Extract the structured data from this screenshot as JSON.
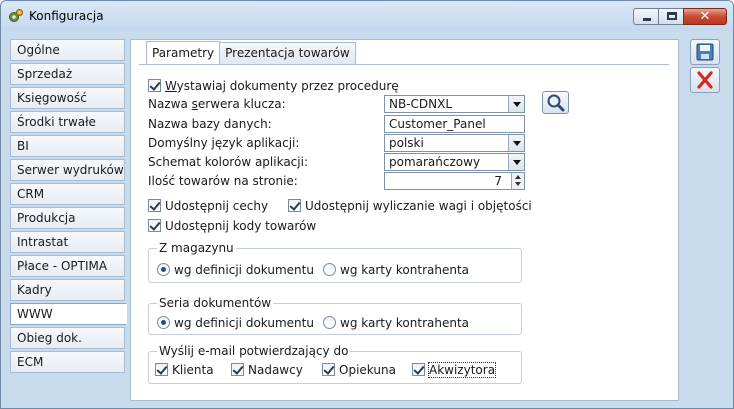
{
  "window": {
    "title": "Konfiguracja",
    "close_label": "✕"
  },
  "sidebar": {
    "items": [
      {
        "label": "Ogólne"
      },
      {
        "label": "Sprzedaż"
      },
      {
        "label": "Księgowość"
      },
      {
        "label": "Środki trwałe"
      },
      {
        "label": "BI"
      },
      {
        "label": "Serwer wydruków"
      },
      {
        "label": "CRM"
      },
      {
        "label": "Produkcja"
      },
      {
        "label": "Intrastat"
      },
      {
        "label": "Płace - OPTIMA"
      },
      {
        "label": "Kadry"
      },
      {
        "label": "WWW"
      },
      {
        "label": "Obieg dok."
      },
      {
        "label": "ECM"
      }
    ],
    "active_index": 11
  },
  "tabs": [
    {
      "label": "Parametry"
    },
    {
      "label": "Prezentacja towarów"
    }
  ],
  "form": {
    "use_procedure": {
      "label_pre": "",
      "label_u": "W",
      "label_post": "ystawiaj dokumenty przez procedurę",
      "checked": true
    },
    "server_key": {
      "label_pre": "Nazwa ",
      "label_u": "s",
      "label_post": "erwera klucza:",
      "value": "NB-CDNXL"
    },
    "db_name": {
      "label": "Nazwa bazy danych:",
      "value": "Customer_Panel"
    },
    "language": {
      "label": "Domyślny język aplikacji:",
      "value": "polski"
    },
    "color_scheme": {
      "label": "Schemat kolorów aplikacji:",
      "value": "pomarańczowy"
    },
    "items_per_page": {
      "label": "Ilość towarów na stronie:",
      "value": "7"
    },
    "share_features": {
      "label": "Udostępnij cechy",
      "checked": true
    },
    "share_weight": {
      "label": "Udostępnij wyliczanie wagi i objętości",
      "checked": true
    },
    "share_codes": {
      "label": "Udostępnij kody towarów",
      "checked": true
    }
  },
  "group_warehouse": {
    "title": "Z magazynu",
    "options": [
      {
        "label": "wg definicji dokumentu",
        "checked": true
      },
      {
        "label": "wg karty kontrahenta",
        "checked": false
      }
    ]
  },
  "group_series": {
    "title": "Seria dokumentów",
    "options": [
      {
        "label": "wg definicji dokumentu",
        "checked": true
      },
      {
        "label": "wg karty kontrahenta",
        "checked": false
      }
    ]
  },
  "group_email": {
    "title": "Wyślij e-mail potwierdzający do",
    "options": [
      {
        "label": "Klienta",
        "checked": true
      },
      {
        "label": "Nadawcy",
        "checked": true
      },
      {
        "label": "Opiekuna",
        "checked": true
      },
      {
        "label": "Akwizytora",
        "checked": true
      }
    ]
  },
  "icons": {
    "app": "gear-icon",
    "lookup": "magnifier-icon",
    "save": "floppy-disk-icon",
    "cancel": "red-x-icon"
  },
  "colors": {
    "accent": "#1f4e8a",
    "cancel": "#d22a1e",
    "close_button": "#c84a32"
  }
}
